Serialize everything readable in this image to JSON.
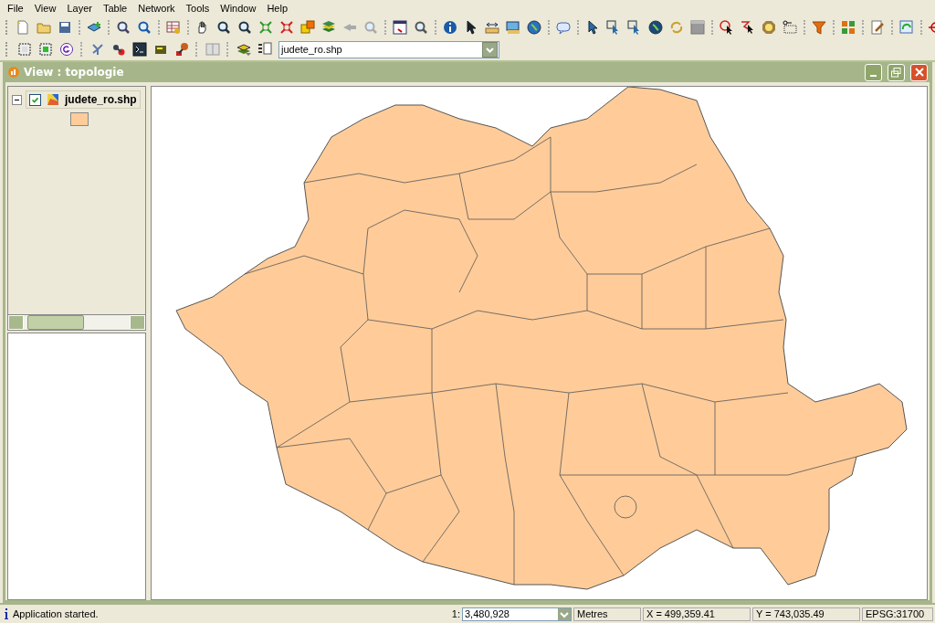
{
  "menu": [
    "File",
    "View",
    "Layer",
    "Table",
    "Network",
    "Tools",
    "Window",
    "Help"
  ],
  "layer_combo": {
    "value": "judete_ro.shp"
  },
  "view": {
    "title": "View : topologie",
    "toc": [
      {
        "name": "judete_ro.shp",
        "checked": true,
        "expanded": true
      }
    ]
  },
  "status_bar": {
    "message": "Application started.",
    "scale_prefix": "1:",
    "scale": "3,480,928",
    "units": "Metres",
    "x": "X = 499,359.41",
    "y": "Y = 743,035.49",
    "crs": "EPSG:31700"
  }
}
